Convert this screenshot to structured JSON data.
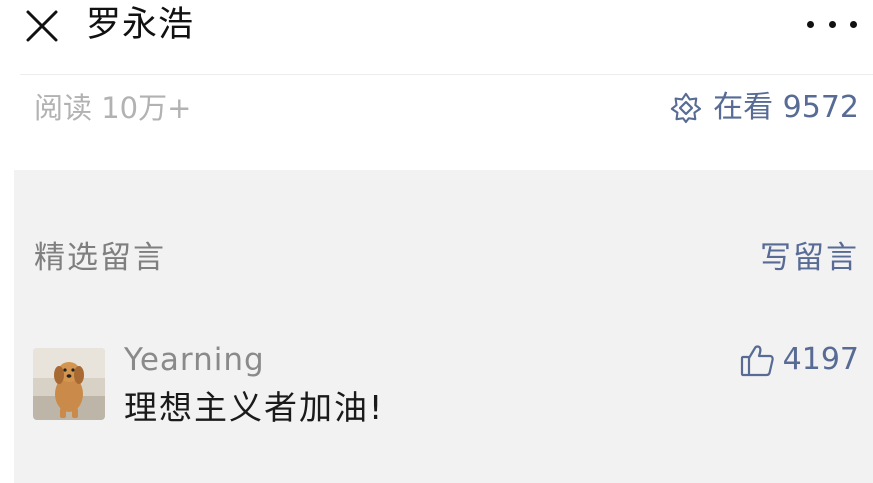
{
  "nav": {
    "title": "罗永浩",
    "close_icon": "close-icon",
    "more_icon": "more-icon"
  },
  "stats": {
    "read_count": "阅读 10万+",
    "watch_label": "在看 9572",
    "watch_icon": "watch-flower-icon"
  },
  "comments": {
    "section_title": "精选留言",
    "write_label": "写留言",
    "items": [
      {
        "nickname": "Yearning",
        "text": "理想主义者加油!",
        "likes": "4197",
        "like_icon": "thumbs-up-icon",
        "avatar": "dog-avatar"
      }
    ]
  },
  "colors": {
    "link": "#576b95",
    "muted": "#b2b2b2",
    "section_bg": "#f2f2f2",
    "text": "#1a1a1a"
  }
}
